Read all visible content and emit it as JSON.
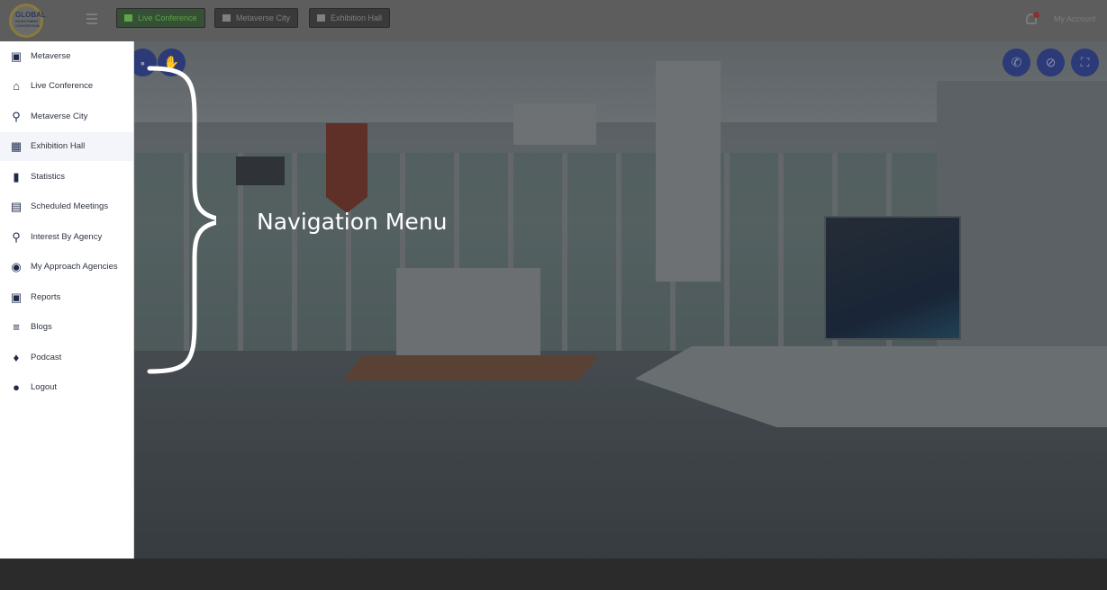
{
  "header": {
    "logo": {
      "line1": "GLOBAL",
      "line2": "INVESTMENT",
      "line3": "CONVENTION"
    },
    "buttons": [
      {
        "label": "Live Conference",
        "icon": "video-camera-icon"
      },
      {
        "label": "Metaverse City",
        "icon": "building-icon"
      },
      {
        "label": "Exhibition Hall",
        "icon": "home-icon"
      }
    ],
    "account_label": "My Account"
  },
  "sidebar": {
    "items": [
      {
        "label": "Metaverse",
        "icon": "metaverse-icon",
        "glyph": "▣"
      },
      {
        "label": "Live Conference",
        "icon": "home-icon",
        "glyph": "⌂"
      },
      {
        "label": "Metaverse City",
        "icon": "location-pin-icon",
        "glyph": "⚲"
      },
      {
        "label": "Exhibition Hall",
        "icon": "cube-icon",
        "glyph": "▦"
      },
      {
        "label": "Statistics",
        "icon": "bar-chart-icon",
        "glyph": "▮"
      },
      {
        "label": "Scheduled Meetings",
        "icon": "calendar-icon",
        "glyph": "▤"
      },
      {
        "label": "Interest By Agency",
        "icon": "search-icon",
        "glyph": "⚲"
      },
      {
        "label": "My Approach Agencies",
        "icon": "eye-icon",
        "glyph": "◉"
      },
      {
        "label": "Reports",
        "icon": "report-icon",
        "glyph": "▣"
      },
      {
        "label": "Blogs",
        "icon": "blog-icon",
        "glyph": "≡"
      },
      {
        "label": "Podcast",
        "icon": "microphone-icon",
        "glyph": "♦"
      },
      {
        "label": "Logout",
        "icon": "logout-user-icon",
        "glyph": "●"
      }
    ],
    "active_index": 3
  },
  "annotation": {
    "text": "Navigation Menu"
  },
  "colors": {
    "sidebar_bg": "#ffffff",
    "sidebar_active_bg": "#f4f5fa",
    "icon_navy": "#1e2a4a",
    "round_button_bg": "#2c3a78",
    "live_button_green": "#5fa34b"
  }
}
